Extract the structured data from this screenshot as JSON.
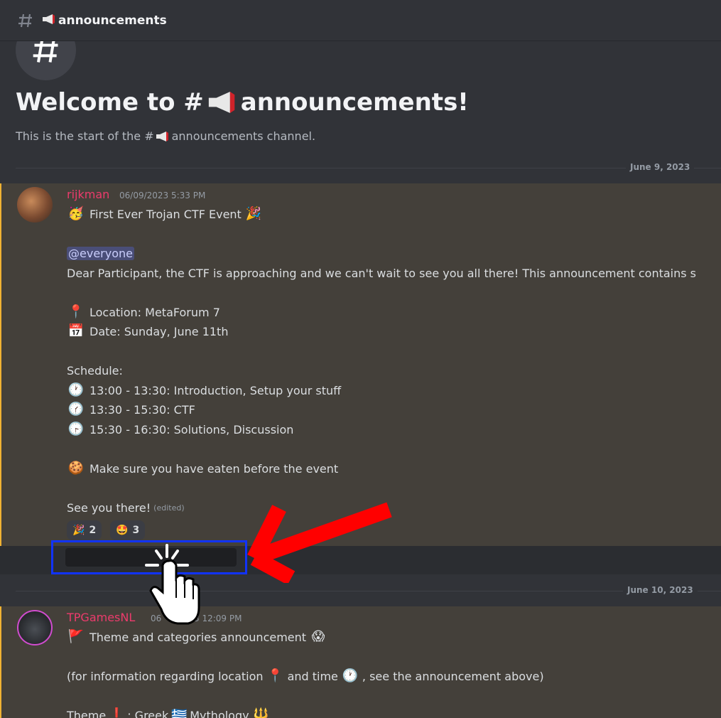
{
  "header": {
    "channel_name": "announcements",
    "hash_icon": "hash-icon",
    "megaphone_icon": "megaphone-icon"
  },
  "welcome": {
    "title_prefix": "Welcome to #",
    "title_suffix": "announcements!",
    "subtitle_prefix": "This is the start of the #",
    "subtitle_suffix": "announcements channel."
  },
  "dividers": [
    {
      "label": "June 9, 2023"
    },
    {
      "label": "June 10, 2023"
    }
  ],
  "messages": [
    {
      "username": "rijkman",
      "username_color": "#ec3b6c",
      "timestamp": "06/09/2023 5:33 PM",
      "title": "First Ever Trojan CTF Event",
      "mention": "@everyone",
      "intro": "Dear Participant, the CTF is approaching and we can't wait to see you all there! This announcement contains s",
      "location": "Location: MetaForum 7",
      "date": "Date: Sunday, June 11th",
      "schedule_label": "Schedule:",
      "schedule": [
        " 13:00 - 13:30: Introduction, Setup your stuff",
        "13:30 - 15:30: CTF",
        "15:30 - 16:30: Solutions, Discussion"
      ],
      "eat_note": "Make sure you have eaten before the event",
      "closing": "See you there!",
      "edited": "(edited)",
      "reactions": [
        {
          "emoji": "🎉",
          "count": "2"
        },
        {
          "emoji": "🤩",
          "count": "3"
        }
      ]
    },
    {
      "username": "TPGamesNL",
      "username_color": "#ec3b6c",
      "timestamp_visible_prefix": "06",
      "timestamp_visible_suffix": "3 12:09 PM",
      "title": "Theme and categories announcement",
      "info_prefix": "(for information regarding location",
      "info_mid": "and time",
      "info_suffix": ", see the announcement above)",
      "theme_prefix": "Theme",
      "theme_mid": ": Greek",
      "theme_suffix": "Mythology"
    }
  ],
  "colors": {
    "background": "#313338",
    "highlighted_message": "#44403a",
    "highlight_border": "#f0b232",
    "annotation_box": "#1133ff",
    "annotation_arrow": "#ff0000"
  }
}
